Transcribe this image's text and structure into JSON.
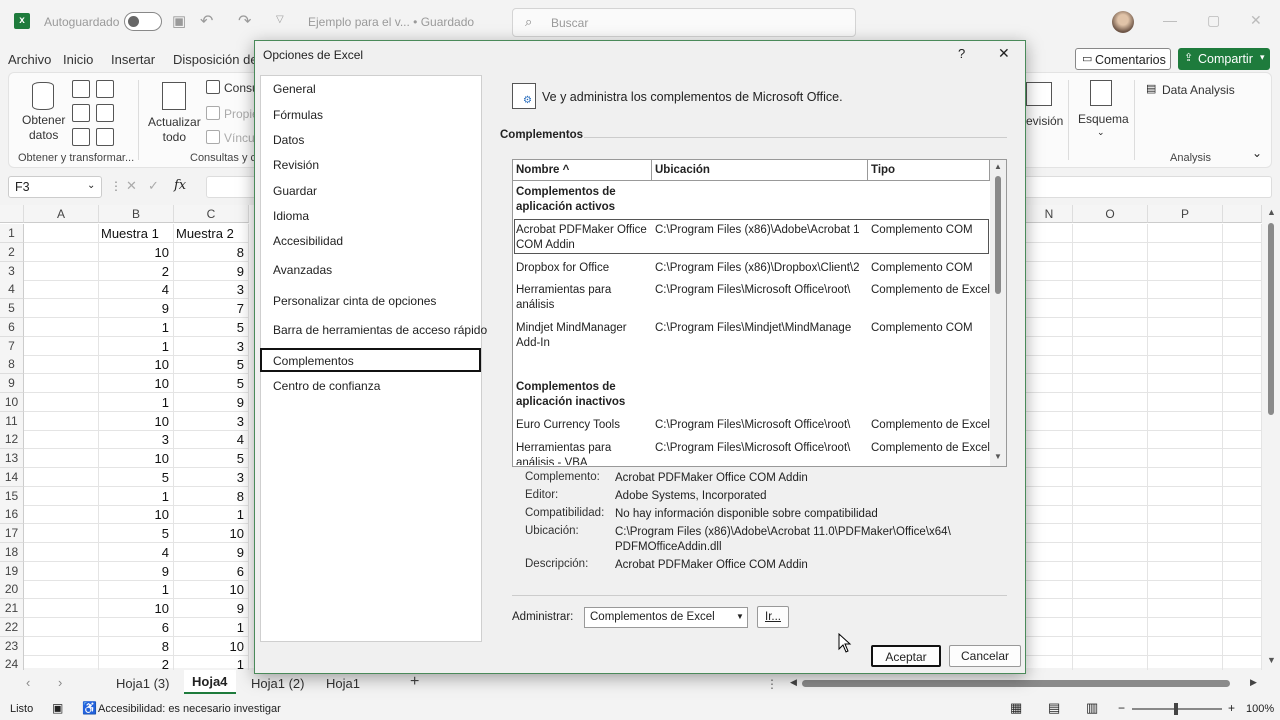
{
  "titlebar": {
    "autosave_label": "Autoguardado",
    "document_title": "Ejemplo para el v... • Guardado",
    "search_placeholder": "Buscar"
  },
  "menu_tabs": [
    "Archivo",
    "Inicio",
    "Insertar",
    "Disposición de"
  ],
  "actions": {
    "comments": "Comentarios",
    "share": "Compartir"
  },
  "ribbon": {
    "get_data": "Obtener\ndatos",
    "get_data_group": "Obtener y transformar...",
    "refresh": "Actualizar\ntodo",
    "queries_group": "Consultas y c",
    "query_items": [
      "Consu",
      "Propie",
      "Víncu"
    ],
    "revision_fragment": "evisión",
    "outline": "Esquema",
    "data_analysis": "Data Analysis",
    "analysis_group": "Analysis"
  },
  "name_box": "F3",
  "columns": [
    "A",
    "B",
    "C",
    "N",
    "O",
    "P"
  ],
  "rows": [
    {
      "n": "1",
      "b": "Muestra 1",
      "c": "Muestra 2"
    },
    {
      "n": "2",
      "b": "10",
      "c": "8"
    },
    {
      "n": "3",
      "b": "2",
      "c": "9"
    },
    {
      "n": "4",
      "b": "4",
      "c": "3"
    },
    {
      "n": "5",
      "b": "9",
      "c": "7"
    },
    {
      "n": "6",
      "b": "1",
      "c": "5"
    },
    {
      "n": "7",
      "b": "1",
      "c": "3"
    },
    {
      "n": "8",
      "b": "10",
      "c": "5"
    },
    {
      "n": "9",
      "b": "10",
      "c": "5"
    },
    {
      "n": "10",
      "b": "1",
      "c": "9"
    },
    {
      "n": "11",
      "b": "10",
      "c": "3"
    },
    {
      "n": "12",
      "b": "3",
      "c": "4"
    },
    {
      "n": "13",
      "b": "10",
      "c": "5"
    },
    {
      "n": "14",
      "b": "5",
      "c": "3"
    },
    {
      "n": "15",
      "b": "1",
      "c": "8"
    },
    {
      "n": "16",
      "b": "10",
      "c": "1"
    },
    {
      "n": "17",
      "b": "5",
      "c": "10"
    },
    {
      "n": "18",
      "b": "4",
      "c": "9"
    },
    {
      "n": "19",
      "b": "9",
      "c": "6"
    },
    {
      "n": "20",
      "b": "1",
      "c": "10"
    },
    {
      "n": "21",
      "b": "10",
      "c": "9"
    },
    {
      "n": "22",
      "b": "6",
      "c": "1"
    },
    {
      "n": "23",
      "b": "8",
      "c": "10"
    },
    {
      "n": "24",
      "b": "2",
      "c": "1"
    }
  ],
  "sheets": [
    "Hoja1 (3)",
    "Hoja4",
    "Hoja1 (2)",
    "Hoja1"
  ],
  "active_sheet": "Hoja4",
  "status": {
    "ready": "Listo",
    "accessibility": "Accesibilidad: es necesario investigar",
    "zoom": "100%"
  },
  "dialog": {
    "title": "Opciones de Excel",
    "help": "?",
    "close": "✕",
    "nav": [
      "General",
      "Fórmulas",
      "Datos",
      "Revisión",
      "Guardar",
      "Idioma",
      "Accesibilidad",
      "Avanzadas",
      "Personalizar cinta de opciones",
      "Barra de herramientas de acceso rápido",
      "Complementos",
      "Centro de confianza"
    ],
    "selected_nav": "Complementos",
    "header_text": "Ve y administra los complementos de Microsoft Office.",
    "section_title": "Complementos",
    "table": {
      "headers": [
        "Nombre ^",
        "Ubicación",
        "Tipo"
      ],
      "active_group": "Complementos de aplicación activos",
      "active_rows": [
        {
          "name": "Acrobat PDFMaker Office COM Addin",
          "location": "C:\\Program Files (x86)\\Adobe\\Acrobat 1",
          "type": "Complemento COM"
        },
        {
          "name": "Dropbox for Office",
          "location": "C:\\Program Files (x86)\\Dropbox\\Client\\2",
          "type": "Complemento COM"
        },
        {
          "name": "Herramientas para análisis",
          "location": "C:\\Program Files\\Microsoft Office\\root\\",
          "type": "Complemento de Excel"
        },
        {
          "name": "Mindjet MindManager Add-In",
          "location": "C:\\Program Files\\Mindjet\\MindManage",
          "type": "Complemento COM"
        }
      ],
      "inactive_group": "Complementos de aplicación inactivos",
      "inactive_rows": [
        {
          "name": "Euro Currency Tools",
          "location": "C:\\Program Files\\Microsoft Office\\root\\",
          "type": "Complemento de Excel"
        },
        {
          "name": "Herramientas para análisis - VBA",
          "location": "C:\\Program Files\\Microsoft Office\\root\\",
          "type": "Complemento de Excel"
        }
      ]
    },
    "details": {
      "addin_label": "Complemento:",
      "addin_value": "Acrobat PDFMaker Office COM Addin",
      "publisher_label": "Editor:",
      "publisher_value": "Adobe Systems, Incorporated",
      "compat_label": "Compatibilidad:",
      "compat_value": "No hay información disponible sobre compatibilidad",
      "location_label": "Ubicación:",
      "location_value": "C:\\Program Files (x86)\\Adobe\\Acrobat 11.0\\PDFMaker\\Office\\x64\\ PDFMOfficeAddin.dll",
      "description_label": "Descripción:",
      "description_value": "Acrobat PDFMaker Office COM Addin"
    },
    "manage_label": "Administrar:",
    "manage_value": "Complementos de Excel",
    "go_button": "Ir...",
    "ok_button": "Aceptar",
    "cancel_button": "Cancelar"
  },
  "colors": {
    "accent": "#1e7b3c",
    "dialog_border": "#4a8a5a"
  }
}
